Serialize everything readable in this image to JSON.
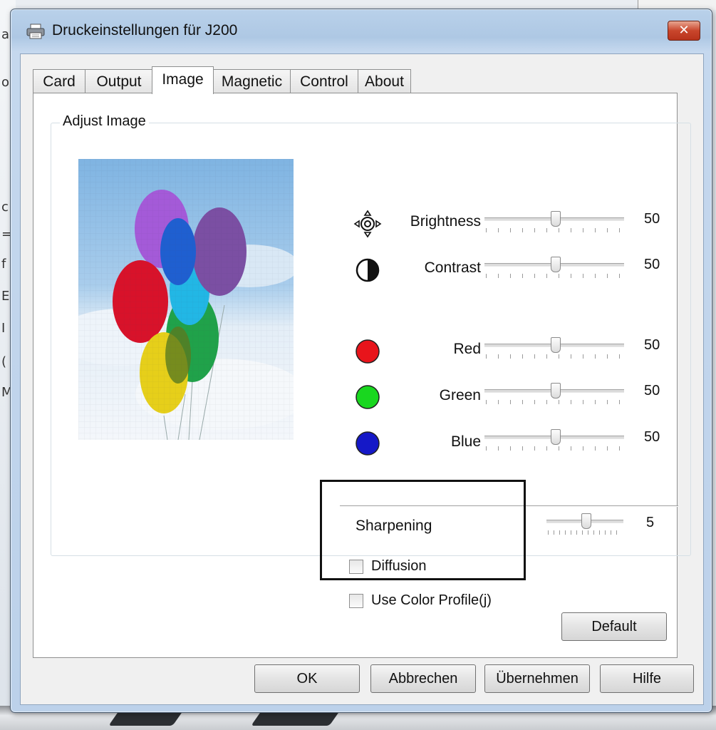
{
  "window": {
    "title": "Druckeinstellungen für J200",
    "close_label": "✕"
  },
  "tabs": [
    {
      "label": "Card",
      "active": false
    },
    {
      "label": "Output",
      "active": false
    },
    {
      "label": "Image",
      "active": true
    },
    {
      "label": "Magnetic",
      "active": false
    },
    {
      "label": "Control",
      "active": false
    },
    {
      "label": "About",
      "active": false
    }
  ],
  "adjust_image": {
    "group_label": "Adjust Image",
    "preview_icon": "balloons-image",
    "sliders": [
      {
        "label": "Brightness",
        "value": "50",
        "icon": "brightness-icon"
      },
      {
        "label": "Contrast",
        "value": "50",
        "icon": "contrast-icon"
      },
      {
        "label": "Red",
        "value": "50",
        "icon": "red-circle-icon",
        "color": "#e8141b"
      },
      {
        "label": "Green",
        "value": "50",
        "icon": "green-circle-icon",
        "color": "#19d71f"
      },
      {
        "label": "Blue",
        "value": "50",
        "icon": "blue-circle-icon",
        "color": "#1518c7"
      }
    ],
    "sharpening": {
      "label": "Sharpening",
      "value": "5"
    },
    "checkboxes": [
      {
        "label": "Diffusion",
        "checked": false
      },
      {
        "label": "Use Color Profile(j)",
        "checked": false
      }
    ],
    "default_button": "Default"
  },
  "footer_buttons": {
    "ok": "OK",
    "cancel": "Abbrechen",
    "apply": "Übernehmen",
    "help": "Hilfe"
  },
  "colors": {
    "accent_red": "#e8141b",
    "accent_green": "#19d71f",
    "accent_blue": "#1518c7",
    "close_button": "#c9462c"
  }
}
